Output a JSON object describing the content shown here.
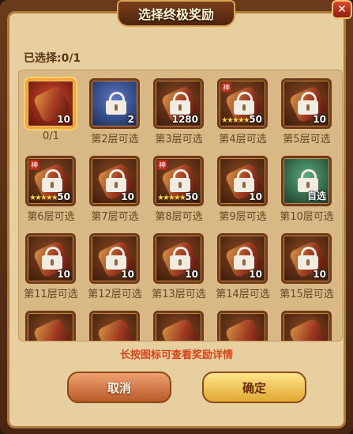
{
  "dialog": {
    "title": "选择终极奖励",
    "close_label": "✕",
    "selected_text": "已选择:0/1",
    "hint": "长按图标可查看奖励详情",
    "cancel_label": "取消",
    "confirm_label": "确定"
  },
  "rewards": [
    {
      "count": "10",
      "label": "0/1",
      "locked": false,
      "selected": true,
      "style": "scroll"
    },
    {
      "count": "2",
      "label": "第2层可选",
      "locked": true,
      "style": "blue"
    },
    {
      "count": "1280",
      "label": "第3层可选",
      "locked": true,
      "style": "scroll"
    },
    {
      "count": "50",
      "label": "第4层可选",
      "locked": true,
      "style": "hero",
      "tag": "神"
    },
    {
      "count": "10",
      "label": "第5层可选",
      "locked": true,
      "style": "scroll"
    },
    {
      "count": "50",
      "label": "第6层可选",
      "locked": true,
      "style": "hero",
      "tag": "神"
    },
    {
      "count": "10",
      "label": "第7层可选",
      "locked": true,
      "style": "scroll"
    },
    {
      "count": "50",
      "label": "第8层可选",
      "locked": true,
      "style": "hero",
      "tag": "神"
    },
    {
      "count": "10",
      "label": "第9层可选",
      "locked": true,
      "style": "scroll"
    },
    {
      "count": "自选",
      "label": "第10层可选",
      "locked": true,
      "style": "green"
    },
    {
      "count": "10",
      "label": "第11层可选",
      "locked": true,
      "style": "scroll"
    },
    {
      "count": "10",
      "label": "第12层可选",
      "locked": true,
      "style": "scroll"
    },
    {
      "count": "10",
      "label": "第13层可选",
      "locked": true,
      "style": "scroll"
    },
    {
      "count": "10",
      "label": "第14层可选",
      "locked": true,
      "style": "scroll"
    },
    {
      "count": "10",
      "label": "第15层可选",
      "locked": true,
      "style": "scroll"
    },
    {
      "count": "",
      "label": "",
      "locked": false,
      "style": "scroll"
    },
    {
      "count": "",
      "label": "",
      "locked": false,
      "style": "scroll"
    },
    {
      "count": "",
      "label": "",
      "locked": false,
      "style": "scroll"
    },
    {
      "count": "",
      "label": "",
      "locked": false,
      "style": "scroll"
    },
    {
      "count": "",
      "label": "",
      "locked": false,
      "style": "scroll"
    }
  ]
}
